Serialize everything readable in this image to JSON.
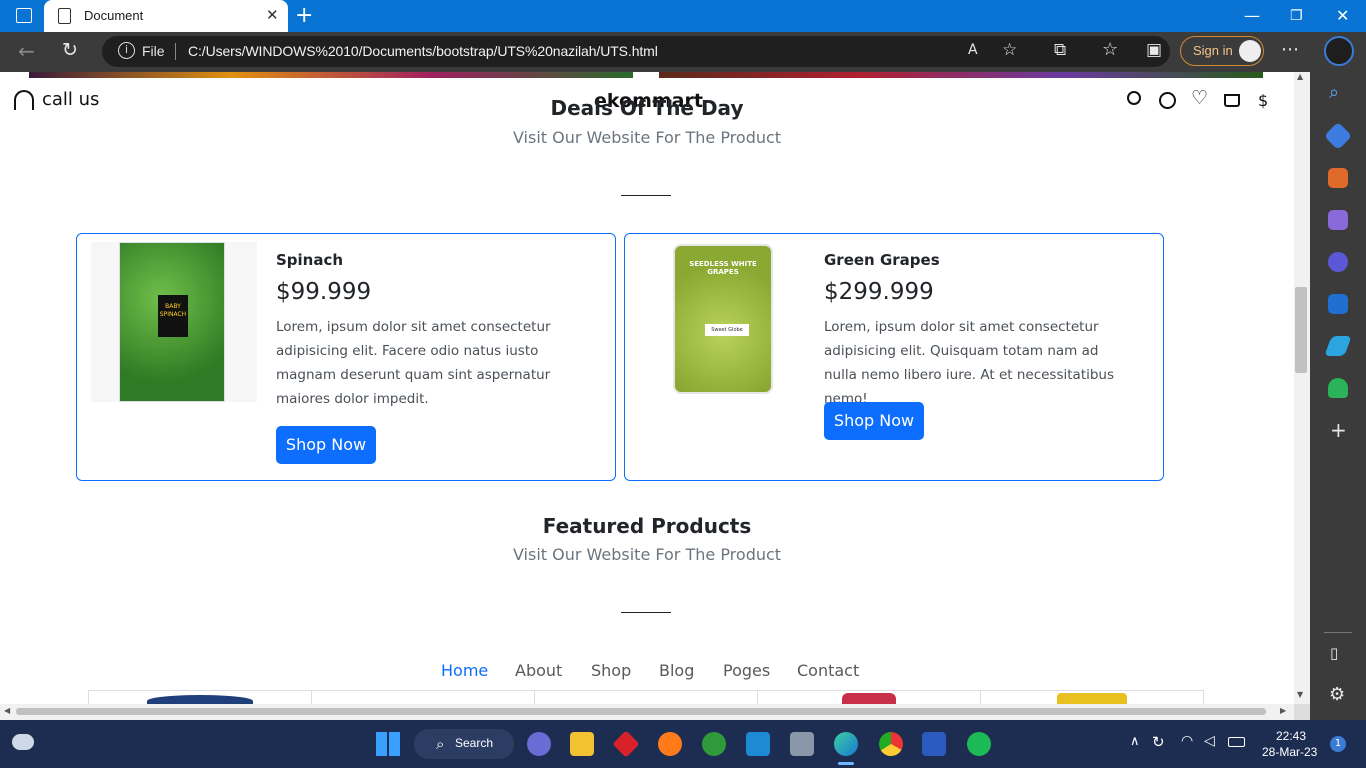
{
  "browser": {
    "tab_title": "Document",
    "file_label": "File",
    "url": "C:/Users/WINDOWS%2010/Documents/bootstrap/UTS%20nazilah/UTS.html",
    "signin_label": "Sign in"
  },
  "site": {
    "call_label": "call us",
    "brand": "ekommart",
    "currency_icon_text": "$"
  },
  "deals": {
    "title": "Deals Of The Day",
    "subtitle": "Visit Our Website For The Product",
    "products": [
      {
        "name": "Spinach",
        "price": "$99.999",
        "description": "Lorem, ipsum dolor sit amet consectetur adipisicing elit. Facere odio natus iusto magnam deserunt quam sint aspernatur maiores dolor impedit.",
        "button": "Shop Now",
        "image_label_1": "BABY",
        "image_label_2": "SPINACH"
      },
      {
        "name": "Green Grapes",
        "price": "$299.999",
        "description": "Lorem, ipsum dolor sit amet consectetur adipisicing elit. Quisquam totam nam ad nulla nemo libero iure. At et necessitatibus nemo!",
        "button": "Shop Now",
        "image_label_1": "SEEDLESS WHITE GRAPES",
        "image_label_2": "Sweet Globe"
      }
    ]
  },
  "featured": {
    "title": "Featured Products",
    "subtitle": "Visit Our Website For The Product"
  },
  "nav": {
    "items": [
      "Home",
      "About",
      "Shop",
      "Blog",
      "Poges",
      "Contact"
    ],
    "active": "Home"
  },
  "taskbar": {
    "search_label": "Search",
    "time": "22:43",
    "date": "28-Mar-23",
    "notification_count": "1"
  },
  "colors": {
    "primary": "#0d6efd",
    "titlebar": "#0a74d4",
    "taskbar": "#1d2d52"
  }
}
